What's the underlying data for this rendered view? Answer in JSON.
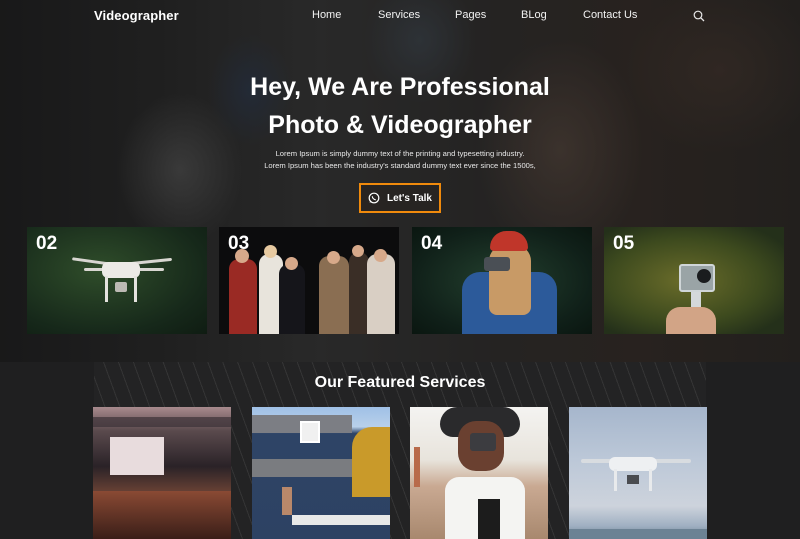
{
  "nav": {
    "brand": "Videographer",
    "items": [
      {
        "label": "Home"
      },
      {
        "label": "Services"
      },
      {
        "label": "Pages"
      },
      {
        "label": "BLog"
      },
      {
        "label": "Contact Us"
      }
    ],
    "search_icon": "search-icon"
  },
  "hero": {
    "headline_line1": "Hey, We Are Professional",
    "headline_line2": "Photo & Videographer",
    "subtext_line1": "Lorem Ipsum is simply dummy text of the printing and typesetting industry.",
    "subtext_line2": "Lorem Ipsum has been the industry's standard dummy text ever since the 1500s,",
    "cta_label": "Let's Talk",
    "cta_icon": "whatsapp-icon",
    "cta_border_color": "#f08a0c"
  },
  "tiles": [
    {
      "number": "02",
      "image": "drone over forest"
    },
    {
      "number": "03",
      "image": "theatre performers on stage"
    },
    {
      "number": "04",
      "image": "woman with camera and red beanie"
    },
    {
      "number": "05",
      "image": "hand holding action camera"
    }
  ],
  "featured": {
    "title": "Our Featured Services",
    "cards": [
      {
        "image": "concert crowd and stage"
      },
      {
        "image": "blue house with porch"
      },
      {
        "image": "woman in hat with camera"
      },
      {
        "image": "drone in sky over sea"
      }
    ]
  }
}
